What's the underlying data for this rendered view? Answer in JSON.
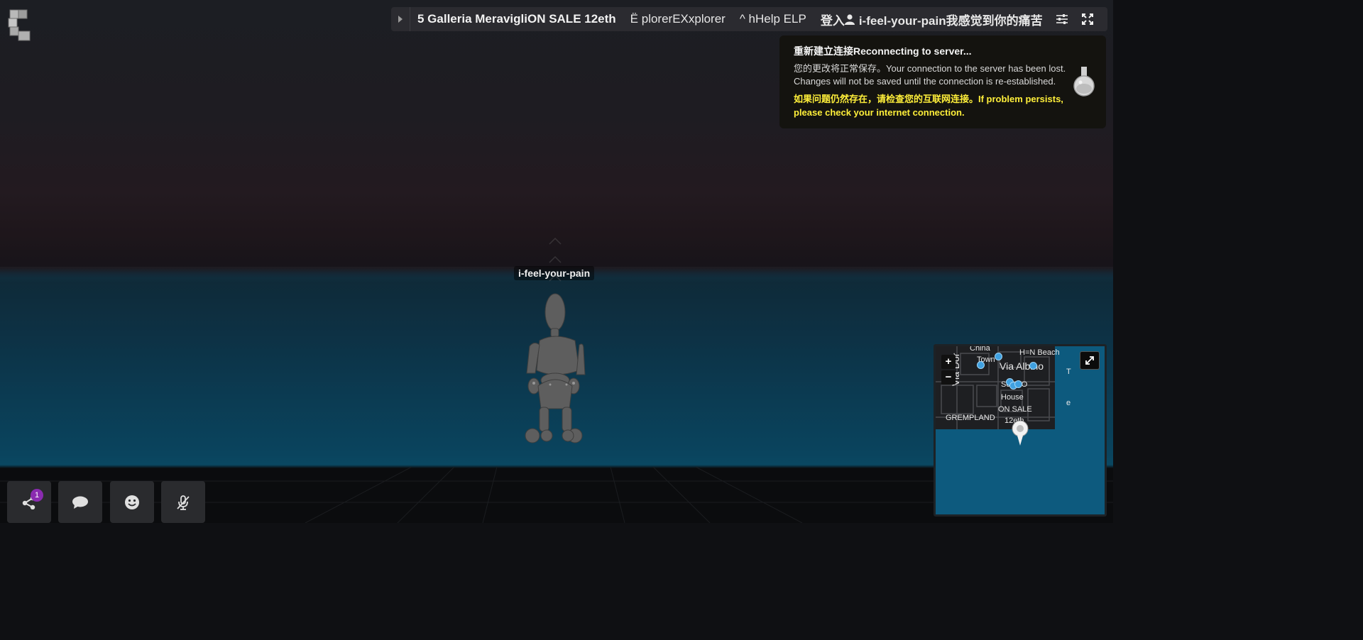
{
  "topbar": {
    "title": "5 Galleria MeravigliON SALE 12eth",
    "explorer": "Ë plorerEXxplorer",
    "help": "^ hHelp ELP",
    "login": "登入",
    "username": "i-feel-your-pain我感觉到你的痛苦"
  },
  "notice": {
    "title": "重新建立连接Reconnecting to server...",
    "body": "您的更改将正常保存。Your connection to the server has been lost. Changes will not be saved until the connection is re-established.",
    "warning": "如果问题仍然存在，请检查您的互联网连接。If problem persists, please check your internet connection."
  },
  "avatar": {
    "name": "i-feel-your-pain"
  },
  "toolbar": {
    "share_badge": "1",
    "icons": [
      "share-icon",
      "chat-icon",
      "emoji-icon",
      "mic-muted-icon"
    ]
  },
  "minimap": {
    "zoom_in": "+",
    "zoom_out": "−",
    "labels": {
      "china_town_1": "China",
      "china_town_2": "Town",
      "beach": "H=N Beach",
      "via_albino": "Via Albino",
      "via_dor": "Via Dor",
      "soho": "SoHAO",
      "house": "House",
      "on_sale": "ON SALE",
      "twelve": "12eth",
      "gremp": "GREMPLAND",
      "t": "T",
      "e": "e"
    }
  },
  "colors": {
    "warning_text": "#ffef3a",
    "badge": "#8a2bb0",
    "water": "#0d5a7e"
  }
}
